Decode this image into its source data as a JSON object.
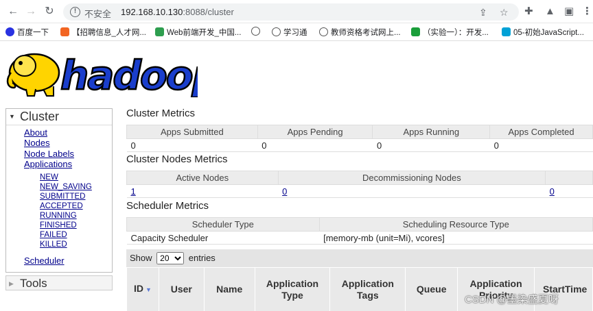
{
  "browser": {
    "insecure_label": "不安全",
    "url_host": "192.168.10.130",
    "url_rest": ":8088/cluster",
    "bookmarks": [
      {
        "label": "百度一下"
      },
      {
        "label": "【招聘信息_人才网..."
      },
      {
        "label": "Web前端开发_中国..."
      },
      {
        "label": ""
      },
      {
        "label": "学习通"
      },
      {
        "label": "教师资格考试网上..."
      },
      {
        "label": "（实验一）：开发..."
      },
      {
        "label": "05-初始JavaScript..."
      }
    ]
  },
  "logo": {
    "text": "hadoop"
  },
  "sidebar": {
    "cluster_label": "Cluster",
    "links": [
      "About",
      "Nodes",
      "Node Labels",
      "Applications"
    ],
    "app_states": [
      "NEW",
      "NEW_SAVING",
      "SUBMITTED",
      "ACCEPTED",
      "RUNNING",
      "FINISHED",
      "FAILED",
      "KILLED"
    ],
    "scheduler_label": "Scheduler",
    "tools_label": "Tools"
  },
  "cluster_metrics": {
    "title": "Cluster Metrics",
    "headers": [
      "Apps Submitted",
      "Apps Pending",
      "Apps Running",
      "Apps Completed"
    ],
    "values": [
      "0",
      "0",
      "0",
      "0"
    ]
  },
  "nodes_metrics": {
    "title": "Cluster Nodes Metrics",
    "headers": [
      "Active Nodes",
      "Decommissioning Nodes",
      ""
    ],
    "values": [
      "1",
      "0",
      "0"
    ]
  },
  "scheduler_metrics": {
    "title": "Scheduler Metrics",
    "headers": [
      "Scheduler Type",
      "Scheduling Resource Type"
    ],
    "values": [
      "Capacity Scheduler",
      "[memory-mb (unit=Mi), vcores]"
    ]
  },
  "apps_table": {
    "show_label": "Show",
    "entries_label": "entries",
    "page_size": "20",
    "columns": [
      "ID",
      "User",
      "Name",
      "Application Type",
      "Application Tags",
      "Queue",
      "Application Priority",
      "StartTime"
    ]
  },
  "watermark": "CSDN @墨染盛夏呀"
}
